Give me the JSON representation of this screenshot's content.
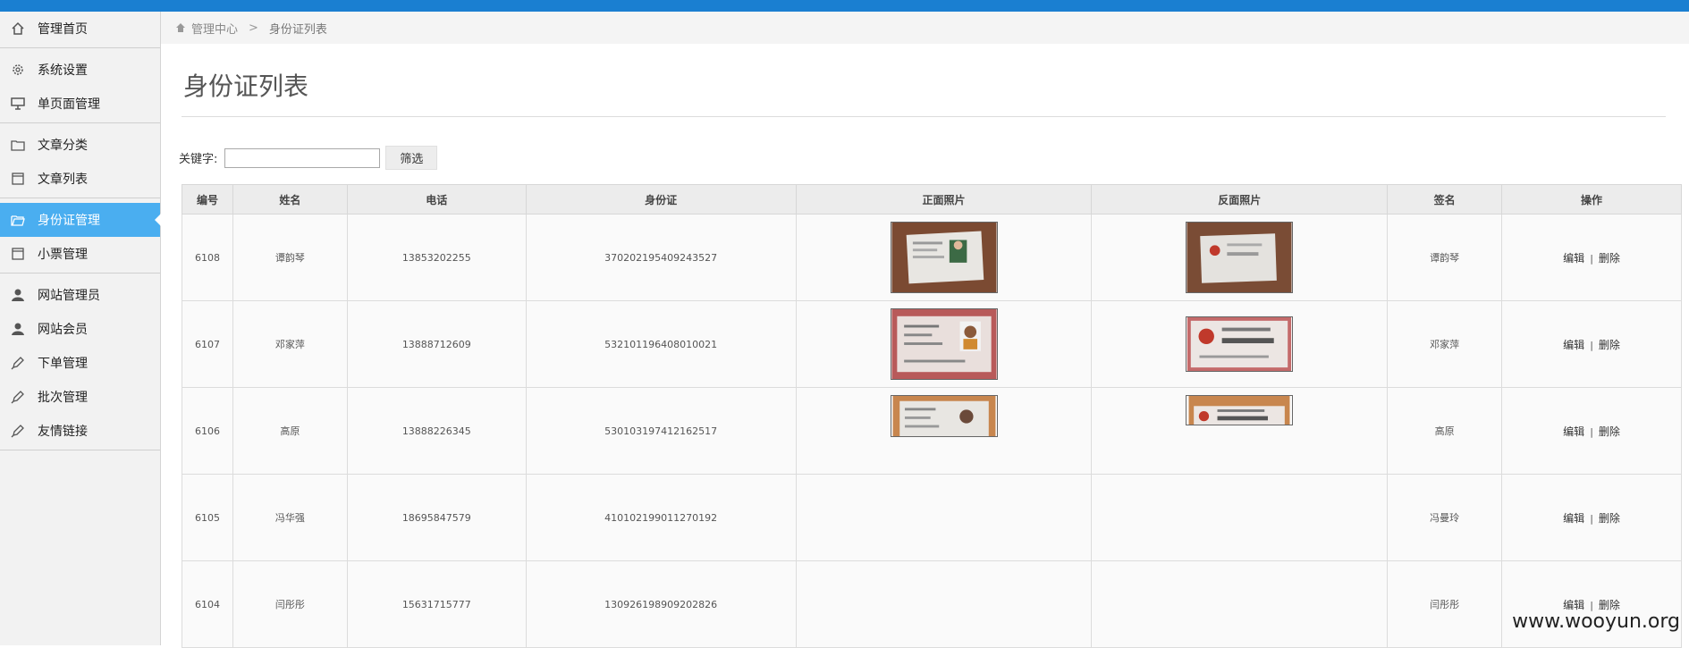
{
  "sidebar": {
    "items": [
      {
        "label": "管理首页",
        "icon": "home-icon"
      },
      {
        "label": "系统设置",
        "icon": "gear-icon"
      },
      {
        "label": "单页面管理",
        "icon": "presentation-icon"
      },
      {
        "label": "文章分类",
        "icon": "folder-icon"
      },
      {
        "label": "文章列表",
        "icon": "calendar-icon"
      },
      {
        "label": "身份证管理",
        "icon": "folder-open-icon",
        "active": true
      },
      {
        "label": "小票管理",
        "icon": "calendar-icon"
      },
      {
        "label": "网站管理员",
        "icon": "user-icon"
      },
      {
        "label": "网站会员",
        "icon": "user-icon"
      },
      {
        "label": "下单管理",
        "icon": "pencil-icon"
      },
      {
        "label": "批次管理",
        "icon": "pencil-icon"
      },
      {
        "label": "友情链接",
        "icon": "pencil-icon"
      }
    ]
  },
  "breadcrumb": {
    "root": "管理中心",
    "current": "身份证列表"
  },
  "page": {
    "title": "身份证列表"
  },
  "filter": {
    "label": "关键字:",
    "value": "",
    "button": "筛选"
  },
  "table": {
    "headers": [
      "编号",
      "姓名",
      "电话",
      "身份证",
      "正面照片",
      "反面照片",
      "签名",
      "操作"
    ],
    "edit_label": "编辑",
    "delete_label": "删除",
    "rows": [
      {
        "id": "6108",
        "name": "谭韵琴",
        "phone": "13853202255",
        "idcard": "370202195409243527",
        "signature": "谭韵琴",
        "front": "id-front-photo",
        "back": "id-back-photo"
      },
      {
        "id": "6107",
        "name": "邓家萍",
        "phone": "13888712609",
        "idcard": "532101196408010021",
        "signature": "邓家萍",
        "front": "id-front-photo",
        "back": "id-back-photo"
      },
      {
        "id": "6106",
        "name": "高原",
        "phone": "13888226345",
        "idcard": "530103197412162517",
        "signature": "高原",
        "front": "id-front-photo",
        "back": "id-back-photo"
      },
      {
        "id": "6105",
        "name": "冯华强",
        "phone": "18695847579",
        "idcard": "410102199011270192",
        "signature": "冯曼玲"
      },
      {
        "id": "6104",
        "name": "闫彤彤",
        "phone": "15631715777",
        "idcard": "130926198909202826",
        "signature": "闫彤彤"
      }
    ]
  },
  "watermark": "www.wooyun.org",
  "colors": {
    "topbar": "#1a7fd1",
    "active_nav": "#4aaef0",
    "sidebar_bg": "#f2f2f2"
  }
}
